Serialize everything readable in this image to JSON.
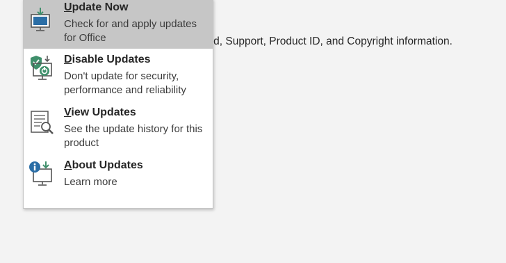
{
  "background": {
    "info_text": "rd, Support, Product ID, and Copyright information."
  },
  "menu": {
    "items": [
      {
        "mnemonic": "U",
        "title_rest": "pdate Now",
        "description": "Check for and apply updates for Office",
        "icon": "update-now-icon",
        "highlighted": true
      },
      {
        "mnemonic": "D",
        "title_rest": "isable Updates",
        "description": "Don't update for security, performance and reliability",
        "icon": "disable-updates-icon",
        "highlighted": false
      },
      {
        "mnemonic": "V",
        "title_rest": "iew Updates",
        "description": "See the update history for this product",
        "icon": "view-updates-icon",
        "highlighted": false
      },
      {
        "mnemonic": "A",
        "title_rest": "bout Updates",
        "description": "Learn more",
        "icon": "about-updates-icon",
        "highlighted": false
      }
    ]
  },
  "colors": {
    "highlight": "#c6c6c6",
    "icon_blue": "#2b6ea6",
    "icon_green": "#3f8f6b"
  }
}
